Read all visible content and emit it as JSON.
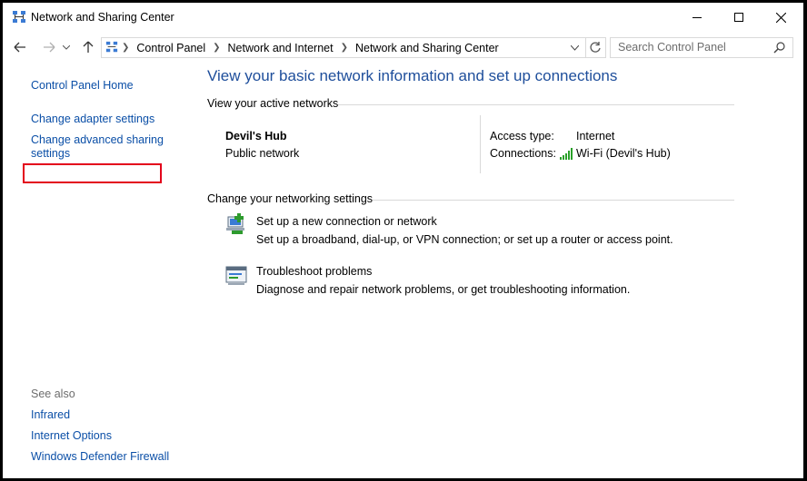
{
  "window": {
    "title": "Network and Sharing Center"
  },
  "address_bar": {
    "breadcrumbs": [
      "Control Panel",
      "Network and Internet",
      "Network and Sharing Center"
    ],
    "search_placeholder": "Search Control Panel"
  },
  "left_pane": {
    "home_link": "Control Panel Home",
    "adapter_link": "Change adapter settings",
    "advanced_link_line1": "Change advanced sharing",
    "advanced_link_line2": "settings",
    "see_also_label": "See also",
    "see_also_links": [
      "Infrared",
      "Internet Options",
      "Windows Defender Firewall"
    ]
  },
  "main": {
    "heading": "View your basic network information and set up connections",
    "active_networks_label": "View your active networks",
    "network_name": "Devil's Hub",
    "network_category": "Public network",
    "access_type_label": "Access type:",
    "access_type_value": "Internet",
    "connections_label": "Connections:",
    "connections_value": "Wi-Fi (Devil's Hub)",
    "change_settings_label": "Change your networking settings",
    "setup_link": "Set up a new connection or network",
    "setup_desc": "Set up a broadband, dial-up, or VPN connection; or set up a router or access point.",
    "troubleshoot_link": "Troubleshoot problems",
    "troubleshoot_desc": "Diagnose and repair network problems, or get troubleshooting information."
  },
  "colors": {
    "link": "#0b4fa7",
    "heading": "#1e4e9b",
    "highlight_border": "#e3001b"
  }
}
